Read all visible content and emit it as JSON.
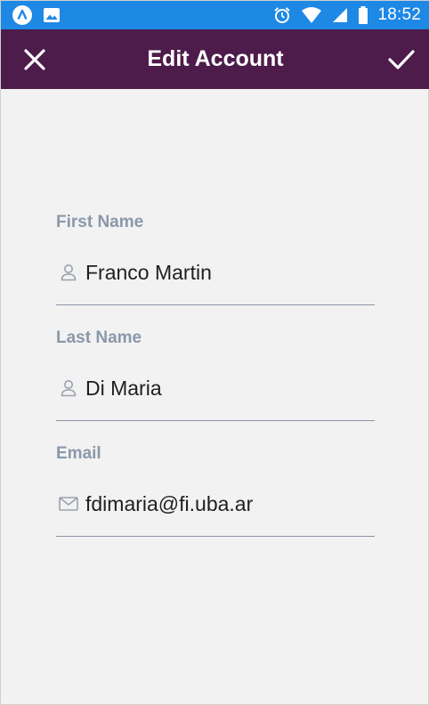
{
  "status_bar": {
    "time": "18:52",
    "left_icons": [
      "app-a-icon",
      "image-icon"
    ],
    "right_icons": [
      "alarm-icon",
      "wifi-icon",
      "signal-icon",
      "battery-icon"
    ]
  },
  "header": {
    "title": "Edit Account",
    "close_icon": "close-icon",
    "confirm_icon": "check-icon",
    "background_color": "#4d1c4b"
  },
  "form": {
    "fields": [
      {
        "label": "First Name",
        "value": "Franco Martin",
        "icon": "person-icon"
      },
      {
        "label": "Last Name",
        "value": "Di Maria",
        "icon": "person-icon"
      },
      {
        "label": "Email",
        "value": "fdimaria@fi.uba.ar",
        "icon": "mail-icon"
      }
    ]
  },
  "colors": {
    "status_bar": "#1e88e5",
    "label": "#8a98ab",
    "underline": "#8a93a8"
  }
}
